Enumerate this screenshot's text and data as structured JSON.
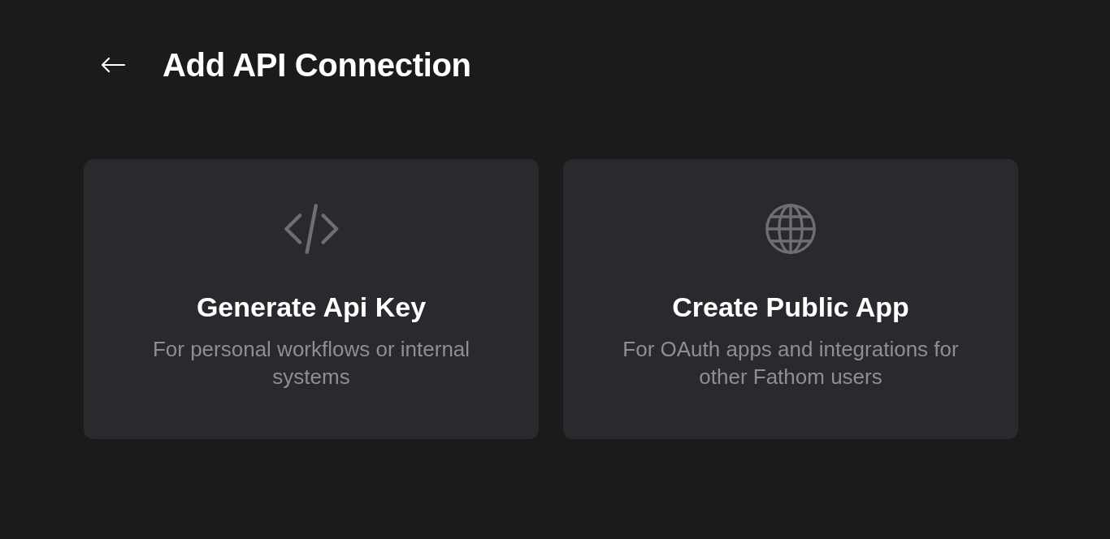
{
  "header": {
    "title": "Add API Connection"
  },
  "options": [
    {
      "kind": "code",
      "title": "Generate Api Key",
      "description": "For personal workflows or internal systems"
    },
    {
      "kind": "globe",
      "title": "Create Public App",
      "description": "For OAuth apps and integrations for other Fathom users"
    }
  ]
}
